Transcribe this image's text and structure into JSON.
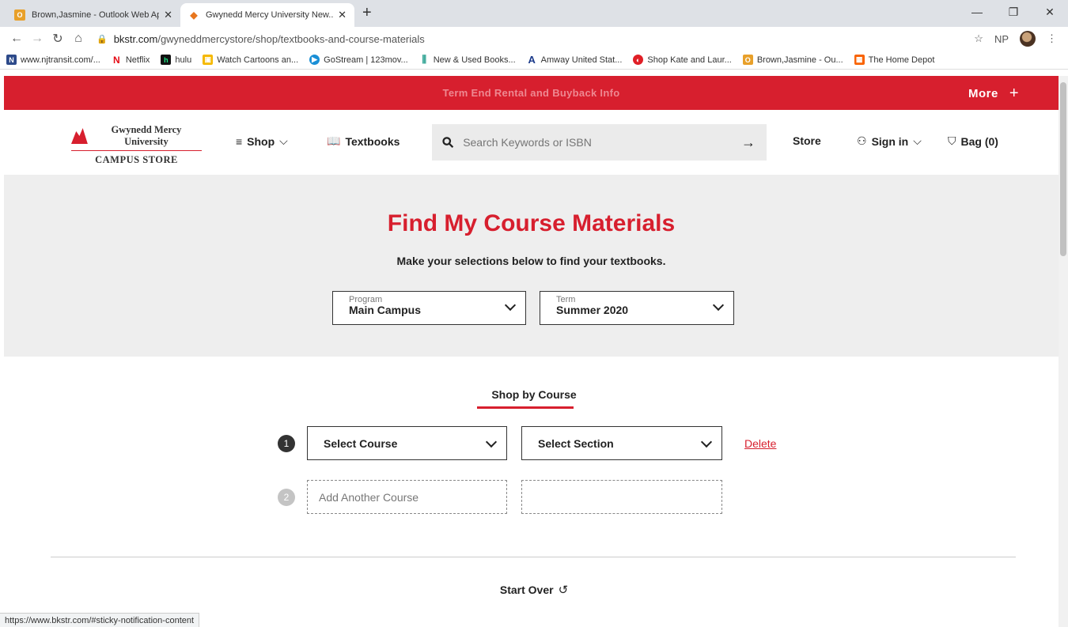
{
  "browser": {
    "tabs": [
      {
        "title": "Brown,Jasmine - Outlook Web App",
        "icon": "outlook-icon",
        "active": false
      },
      {
        "title": "Gwynedd Mercy University New...",
        "icon": "bkstr-icon",
        "active": true
      }
    ],
    "url_domain": "bkstr.com",
    "url_path": "/gwyneddmercystore/shop/textbooks-and-course-materials",
    "profile_initials": "NP",
    "bookmarks": [
      {
        "label": "www.njtransit.com/...",
        "icon": "njtransit-icon"
      },
      {
        "label": "Netflix",
        "icon": "netflix-icon"
      },
      {
        "label": "hulu",
        "icon": "hulu-icon"
      },
      {
        "label": "Watch Cartoons an...",
        "icon": "cartoons-icon"
      },
      {
        "label": "GoStream | 123mov...",
        "icon": "gostream-icon"
      },
      {
        "label": "New & Used Books...",
        "icon": "books-icon"
      },
      {
        "label": "Amway United Stat...",
        "icon": "amway-icon"
      },
      {
        "label": "Shop Kate and Laur...",
        "icon": "shop-icon"
      },
      {
        "label": "Brown,Jasmine - Ou...",
        "icon": "outlook-icon"
      },
      {
        "label": "The Home Depot",
        "icon": "homedepot-icon"
      }
    ],
    "status_url": "https://www.bkstr.com/#sticky-notification-content"
  },
  "promo": {
    "message": "Term End Rental and Buyback Info",
    "more_label": "More",
    "more_icon": "+"
  },
  "header": {
    "logo_university": "Gwynedd Mercy University",
    "logo_store": "CAMPUS STORE",
    "shop_label": "Shop",
    "textbooks_label": "Textbooks",
    "search_placeholder": "Search Keywords or ISBN",
    "store_label": "Store",
    "signin_label": "Sign in",
    "bag_label": "Bag (0)"
  },
  "hero": {
    "title": "Find My Course Materials",
    "subtitle": "Make your selections below to find your textbooks.",
    "program_label": "Program",
    "program_value": "Main Campus",
    "term_label": "Term",
    "term_value": "Summer 2020"
  },
  "course": {
    "heading": "Shop by Course",
    "row1_number": "1",
    "select_course": "Select Course",
    "select_section": "Select Section",
    "delete_label": "Delete",
    "row2_number": "2",
    "add_another_placeholder": "Add Another Course",
    "start_over": "Start Over"
  },
  "colors": {
    "brand_red": "#d71f2e",
    "hero_bg": "#eeeeee"
  }
}
